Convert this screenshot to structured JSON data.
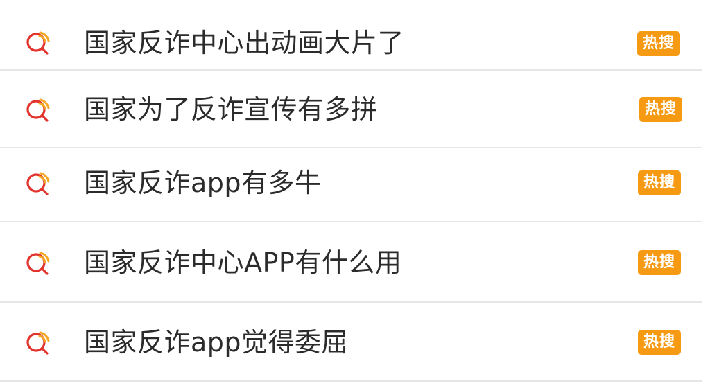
{
  "hot_search": {
    "items": [
      {
        "label": "国家反诈中心出动画大片了",
        "badge": "热搜"
      },
      {
        "label": "国家为了反诈宣传有多拼",
        "badge": "热搜"
      },
      {
        "label": "国家反诈app有多牛",
        "badge": "热搜"
      },
      {
        "label": "国家反诈中心APP有什么用",
        "badge": "热搜"
      },
      {
        "label": "国家反诈app觉得委屈",
        "badge": "热搜"
      }
    ],
    "icon": "search-icon",
    "colors": {
      "badge_bg": "#f59a12",
      "icon_red": "#e2342c",
      "icon_orange": "#f5a623",
      "text": "#2b2b2b",
      "divider": "#e6e6e9"
    }
  }
}
